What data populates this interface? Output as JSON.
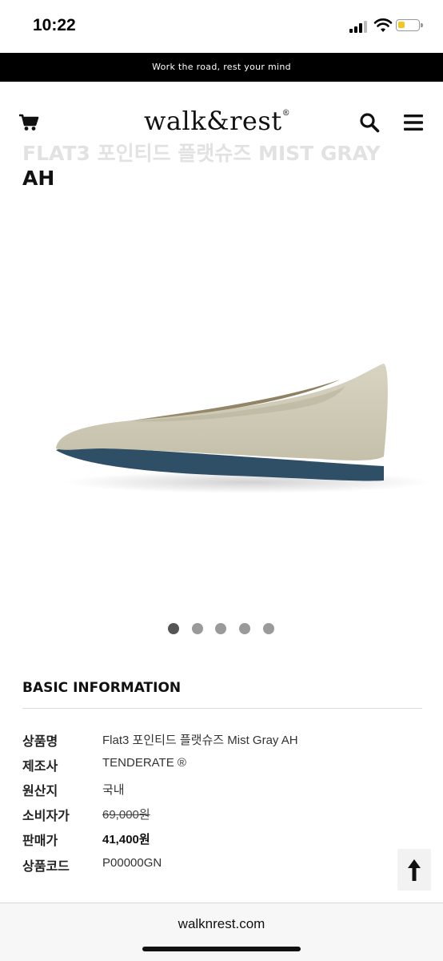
{
  "status_bar": {
    "time": "10:22",
    "battery_color": "#f3c623"
  },
  "promo": {
    "text": "Work the road, rest your mind"
  },
  "header": {
    "logo_text": "walk&rest",
    "logo_mark": "®",
    "icons": [
      "cart-icon",
      "search-icon",
      "menu-icon"
    ]
  },
  "product": {
    "title_line1": "FLAT3 포인티드 플랫슈즈 MIST GRAY",
    "title_line2": "AH",
    "image_dot_count": 5,
    "active_dot": 0
  },
  "basic_info": {
    "heading": "BASIC INFORMATION",
    "rows": [
      {
        "label": "상품명",
        "value": "Flat3 포인티드 플랫슈즈 Mist Gray AH"
      },
      {
        "label": "제조사",
        "value": "TENDERATE ®"
      },
      {
        "label": "원산지",
        "value": "국내"
      },
      {
        "label": "소비자가",
        "value": "69,000원"
      },
      {
        "label": "판매가",
        "value": "41,400원"
      },
      {
        "label": "상품코드",
        "value": "P00000GN"
      }
    ]
  },
  "scroll_top": {
    "icon": "arrow-up-icon"
  },
  "browser": {
    "url": "walknrest.com"
  }
}
